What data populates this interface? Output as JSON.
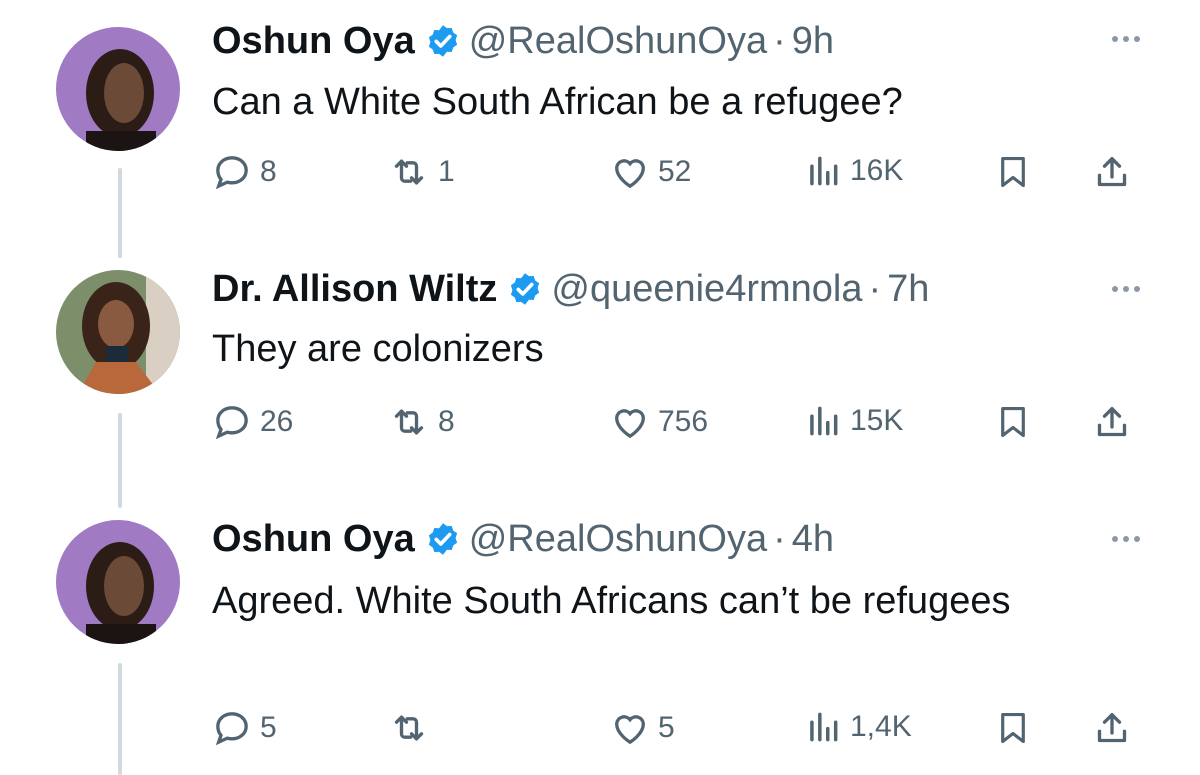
{
  "tweets": [
    {
      "author": "Oshun Oya",
      "handle": "@RealOshunOya",
      "separator": "·",
      "time": "9h",
      "text": "Can a White South African be a refugee?",
      "replies": "8",
      "retweets": "1",
      "likes": "52",
      "views": "16K"
    },
    {
      "author": "Dr. Allison Wiltz",
      "handle": "@queenie4rmnola",
      "separator": "·",
      "time": "7h",
      "text": "They are colonizers",
      "replies": "26",
      "retweets": "8",
      "likes": "756",
      "views": "15K"
    },
    {
      "author": "Oshun Oya",
      "handle": "@RealOshunOya",
      "separator": "·",
      "time": "4h",
      "text": "Agreed. White South Africans can’t be refugees",
      "replies": "5",
      "retweets": "",
      "likes": "5",
      "views": "1,4K"
    }
  ],
  "colors": {
    "verified": "#1d9bf0",
    "secondary_text": "#536471",
    "thread_line": "#cfd9de",
    "avatar_oshun_bg": "#a07bc4",
    "avatar_allison_bg": "#7c8f6a"
  },
  "icons": [
    "reply-icon",
    "retweet-icon",
    "like-icon",
    "views-icon",
    "bookmark-icon",
    "share-icon",
    "more-icon",
    "verified-badge-icon"
  ]
}
